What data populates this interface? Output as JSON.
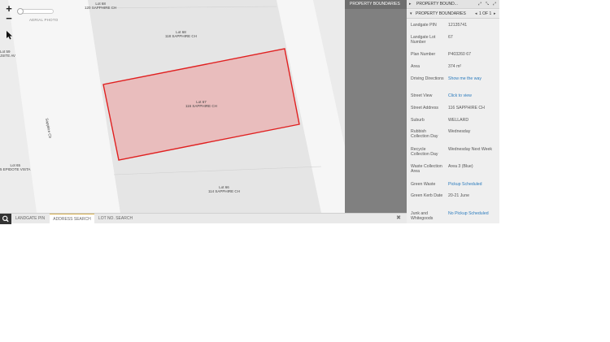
{
  "map": {
    "aerial_photo_label": "AERIAL PHOTO",
    "zoom_in": "+",
    "zoom_out": "−",
    "lot_labels": [
      {
        "lot": "Lot 68",
        "street": "120 SAPPHIRE CH"
      },
      {
        "lot": "Lot 68",
        "street": "118 SAPPHIRE CH"
      },
      {
        "lot": "Lot 67",
        "street": "116 SAPPHIRE CH"
      },
      {
        "lot": "Lot 66",
        "street": "114 SAPPHIRE CH"
      },
      {
        "lot": "Lot 65",
        "street": "5 EPIDOTE VISTA"
      },
      {
        "lot": "Lot 59",
        "street": "JSITE AV"
      }
    ],
    "road_label": "Sapphire Ch",
    "colors": {
      "parcel_fill": "#e9b8b8",
      "parcel_stroke": "#e02020",
      "road": "#f4f4f4",
      "block": "#e6e6e6"
    }
  },
  "layer_column": {
    "header": "PROPERTY BOUNDARIES"
  },
  "bottom_bar": {
    "tabs": [
      {
        "label": "LANDGATE PIN",
        "active": false
      },
      {
        "label": "ADDRESS SEARCH",
        "active": true
      },
      {
        "label": "LOT NO. SEARCH",
        "active": false
      }
    ],
    "close": "✖"
  },
  "panel": {
    "header_title": "PROPERTY BOUND...",
    "subheader_title": "PROPERTY BOUNDARIES",
    "pager": "1 OF 1",
    "rows": [
      {
        "key": "Landgate PIN",
        "value": "12135741",
        "link": false
      },
      {
        "key": "Landgate Lot Number",
        "value": "67",
        "link": false
      },
      {
        "key": "Plan Number",
        "value": "P403260 67",
        "link": false
      },
      {
        "key": "Area",
        "value": "374 m²",
        "link": false
      },
      {
        "key": "Driving Directions",
        "value": "Show me the way",
        "link": true
      },
      {
        "key": "Street View",
        "value": "Click to view",
        "link": true
      },
      {
        "key": "Street Address",
        "value": "116 SAPPHIRE CH",
        "link": false
      },
      {
        "key": "Suburb",
        "value": "WELLARD",
        "link": false
      },
      {
        "key": "Rubbish Collection Day",
        "value": "Wednesday",
        "link": false
      },
      {
        "key": "Recycle Collection Day",
        "value": "Wednesday Next Week",
        "link": false
      },
      {
        "key": "Waste Collection Area",
        "value": "Area 3 (Blue)",
        "link": false
      },
      {
        "key": "Green Waste",
        "value": "Pickup Scheduled",
        "link": true
      },
      {
        "key": "Green Kerb Date",
        "value": "20-21 June",
        "link": false
      },
      {
        "key": "Junk and Whitegoods",
        "value": "No Pickup Scheduled",
        "link": true
      }
    ],
    "colors": {
      "link": "#2b7bbd"
    }
  }
}
